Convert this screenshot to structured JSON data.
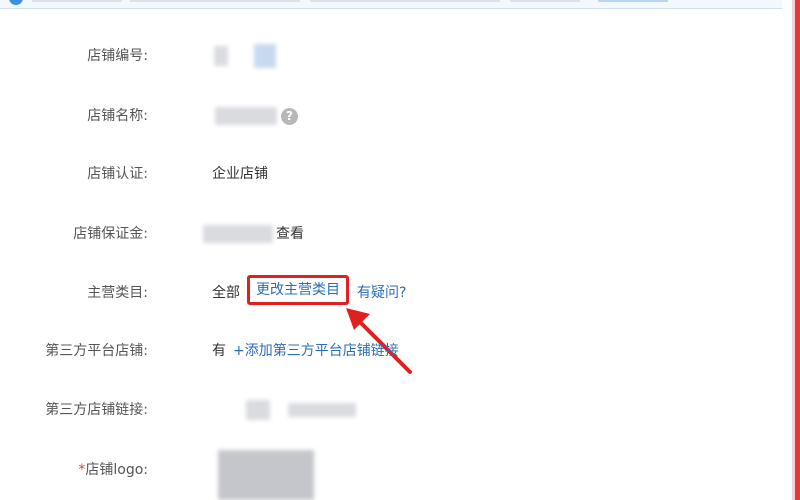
{
  "rows": {
    "shop_id": {
      "label": "店铺编号:"
    },
    "shop_name": {
      "label": "店铺名称:",
      "help_icon": "?"
    },
    "certification": {
      "label": "店铺认证:",
      "value": "企业店铺"
    },
    "deposit": {
      "label": "店铺保证金:",
      "action": "查看"
    },
    "category": {
      "label": "主营类目:",
      "value": "全部",
      "change_button": "更改主营类目",
      "faq_link": "有疑问?"
    },
    "third_party": {
      "label": "第三方平台店铺:",
      "value": "有",
      "add_link": "+添加第三方平台店铺链接"
    },
    "third_party_link": {
      "label": "第三方店铺链接:"
    },
    "logo": {
      "required_mark": "*",
      "label": "店铺logo:"
    }
  },
  "notice": {
    "icon": "info-icon"
  },
  "annotation": {
    "arrow_icon": "red-arrow-icon",
    "highlight_color": "#e02020"
  },
  "colors": {
    "link": "#2b6cb8",
    "accent_red": "#e02020"
  }
}
